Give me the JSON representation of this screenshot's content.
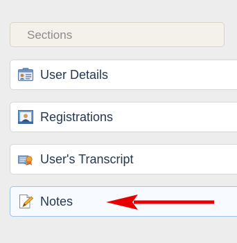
{
  "sidebar": {
    "header": "Sections",
    "items": [
      {
        "label": "User Details",
        "icon": "id-card-icon"
      },
      {
        "label": "Registrations",
        "icon": "user-photo-icon"
      },
      {
        "label": "User's Transcript",
        "icon": "certificate-icon"
      },
      {
        "label": "Notes",
        "icon": "note-pencil-icon",
        "active": true
      }
    ]
  },
  "colors": {
    "label_text": "#26374f",
    "header_text": "#8b8b8b",
    "active_border": "#9fc3e7",
    "arrow": "#e60000"
  }
}
